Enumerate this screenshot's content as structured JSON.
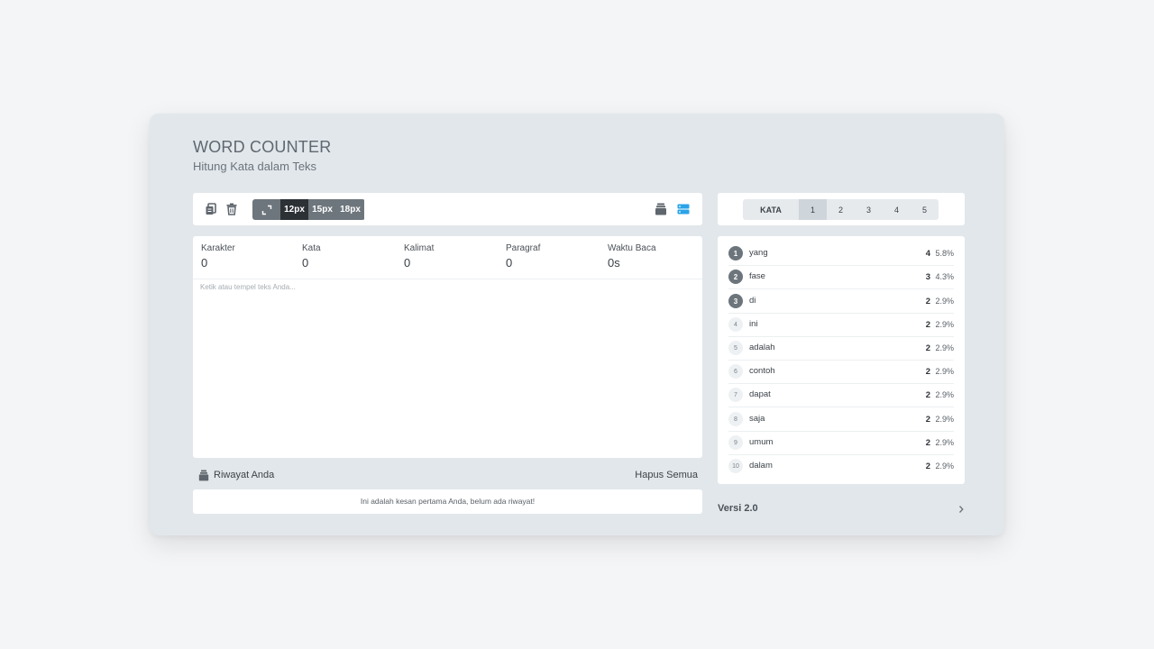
{
  "header": {
    "title": "WORD COUNTER",
    "subtitle": "Hitung Kata dalam Teks"
  },
  "toolbar": {
    "copy_icon": "copy-icon",
    "delete_icon": "trash-icon",
    "expand_icon": "expand-icon",
    "font_sizes": [
      "12px",
      "15px",
      "18px"
    ],
    "active_font_size": "12px",
    "history_icon": "archive-icon",
    "layout_icon": "layout-toggle-icon",
    "accent_color": "#2aa3e8"
  },
  "stats": [
    {
      "label": "Karakter",
      "value": "0"
    },
    {
      "label": "Kata",
      "value": "0"
    },
    {
      "label": "Kalimat",
      "value": "0"
    },
    {
      "label": "Paragraf",
      "value": "0"
    },
    {
      "label": "Waktu Baca",
      "value": "0s"
    }
  ],
  "editor": {
    "placeholder": "Ketik atau tempel teks Anda..."
  },
  "history": {
    "title": "Riwayat Anda",
    "clear_label": "Hapus Semua",
    "empty_message": "Ini adalah kesan pertama Anda, belum ada riwayat!"
  },
  "tabs": {
    "label": "KATA",
    "items": [
      "1",
      "2",
      "3",
      "4",
      "5"
    ],
    "active": "1"
  },
  "words": [
    {
      "rank": "1",
      "word": "yang",
      "count": "4",
      "pct": "5.8%"
    },
    {
      "rank": "2",
      "word": "fase",
      "count": "3",
      "pct": "4.3%"
    },
    {
      "rank": "3",
      "word": "di",
      "count": "2",
      "pct": "2.9%"
    },
    {
      "rank": "4",
      "word": "ini",
      "count": "2",
      "pct": "2.9%"
    },
    {
      "rank": "5",
      "word": "adalah",
      "count": "2",
      "pct": "2.9%"
    },
    {
      "rank": "6",
      "word": "contoh",
      "count": "2",
      "pct": "2.9%"
    },
    {
      "rank": "7",
      "word": "dapat",
      "count": "2",
      "pct": "2.9%"
    },
    {
      "rank": "8",
      "word": "saja",
      "count": "2",
      "pct": "2.9%"
    },
    {
      "rank": "9",
      "word": "umum",
      "count": "2",
      "pct": "2.9%"
    },
    {
      "rank": "10",
      "word": "dalam",
      "count": "2",
      "pct": "2.9%"
    }
  ],
  "footer": {
    "version": "Versi 2.0"
  }
}
